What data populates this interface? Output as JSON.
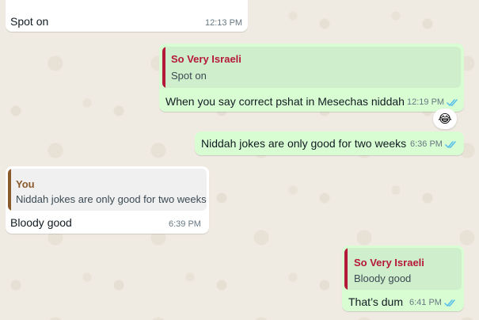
{
  "colors": {
    "incoming_bg": "#ffffff",
    "outgoing_bg": "#d9fdd3",
    "quote_outgoing_bg": "#cfeecb",
    "quote_incoming_bg": "#f0f0f0",
    "quote_author_red": "#b5193a",
    "quote_author_brown": "#8b5a2b",
    "tick_blue": "#53bdeb"
  },
  "messages": [
    {
      "id": "m1",
      "direction": "incoming",
      "text": "Spot on",
      "time": "12:13 PM",
      "partial_text": "..."
    },
    {
      "id": "m2",
      "direction": "outgoing",
      "quote": {
        "author": "So Very Israeli",
        "text": "Spot on"
      },
      "text": "When you say correct pshat in Mesechas niddah",
      "time": "12:19 PM",
      "status_icon": "double-check-read-icon",
      "reaction": "😂"
    },
    {
      "id": "m3",
      "direction": "outgoing",
      "text": "Niddah jokes are only good for two weeks",
      "time": "6:36 PM",
      "status_icon": "double-check-read-icon"
    },
    {
      "id": "m4",
      "direction": "incoming",
      "quote": {
        "author": "You",
        "text": "Niddah jokes are only good for two weeks"
      },
      "text": "Bloody good",
      "time": "6:39 PM"
    },
    {
      "id": "m5",
      "direction": "outgoing",
      "quote": {
        "author": "So Very Israeli",
        "text": "Bloody good"
      },
      "text": "That’s dum",
      "time": "6:41 PM",
      "status_icon": "double-check-read-icon"
    }
  ]
}
